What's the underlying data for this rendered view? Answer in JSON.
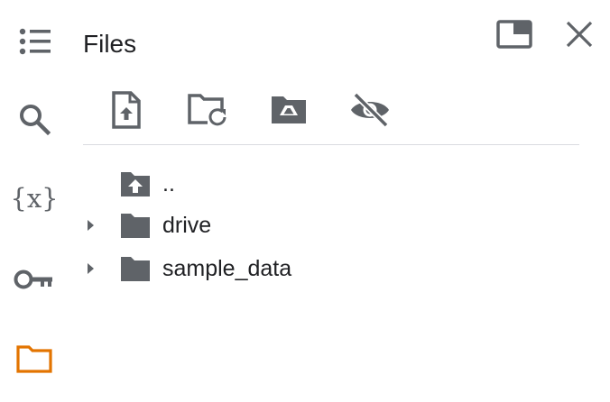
{
  "panel": {
    "title": "Files"
  },
  "sidebar": {
    "items": [
      {
        "icon": "table-of-contents-icon",
        "active": false
      },
      {
        "icon": "search-icon",
        "active": false
      },
      {
        "icon": "variables-icon",
        "label": "{x}",
        "active": false
      },
      {
        "icon": "key-icon",
        "active": false
      },
      {
        "icon": "folder-icon",
        "active": true
      }
    ],
    "active_color": "#e37400",
    "icon_color": "#5f6368"
  },
  "header_actions": [
    {
      "icon": "open-in-tab-icon"
    },
    {
      "icon": "close-icon"
    }
  ],
  "toolbar": [
    {
      "icon": "upload-file-icon"
    },
    {
      "icon": "refresh-folder-icon"
    },
    {
      "icon": "mount-drive-icon"
    },
    {
      "icon": "hide-hidden-files-icon"
    }
  ],
  "file_tree": [
    {
      "name": "..",
      "type": "parent",
      "icon": "folder-upload-icon"
    },
    {
      "name": "drive",
      "type": "folder",
      "icon": "folder-icon",
      "expanded": false
    },
    {
      "name": "sample_data",
      "type": "folder",
      "icon": "folder-icon",
      "expanded": false
    }
  ]
}
